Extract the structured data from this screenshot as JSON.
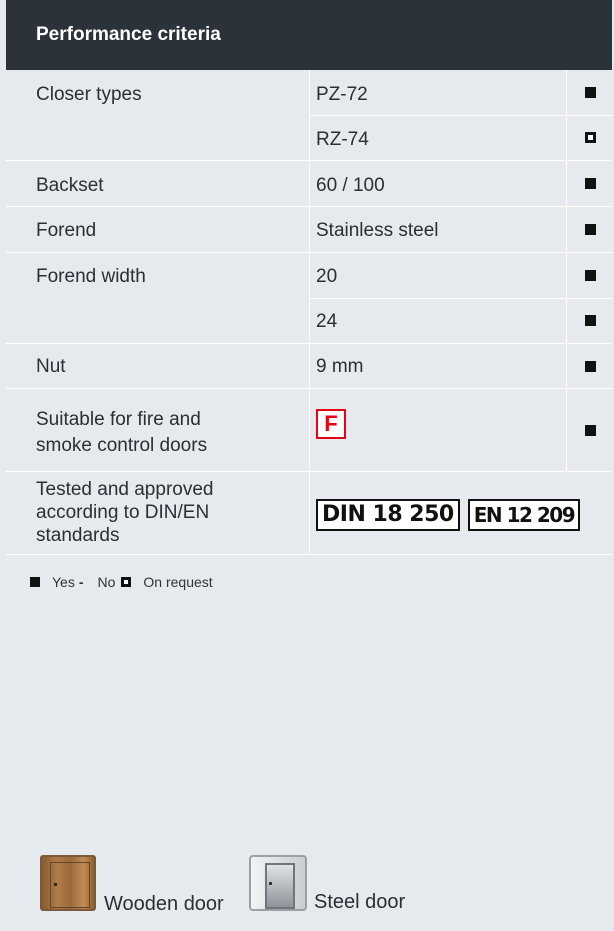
{
  "header": {
    "title": "Performance criteria"
  },
  "rows": {
    "closer_types": {
      "label": "Closer types",
      "value1": "PZ-72",
      "value2": "RZ-74"
    },
    "backset": {
      "label": "Backset",
      "value": "60 / 100"
    },
    "forend": {
      "label": "Forend",
      "value": "Stainless steel"
    },
    "forend_width": {
      "label": "Forend width",
      "value1": "20",
      "value2": "24"
    },
    "nut": {
      "label": "Nut",
      "value": "9 mm"
    },
    "fire": {
      "label_line1": "Suitable for fire and",
      "label_line2": "smoke control doors",
      "mark": "F"
    },
    "tested": {
      "label_line1": "Tested and approved",
      "label_line2": "according to DIN/EN",
      "label_line3": "standards",
      "din": "DIN 18 250",
      "en": "EN 12 209"
    }
  },
  "legend": {
    "yes": "Yes",
    "dash": "-",
    "no": "No",
    "request": "On request"
  },
  "doors": {
    "wooden": "Wooden door",
    "steel": "Steel door"
  }
}
